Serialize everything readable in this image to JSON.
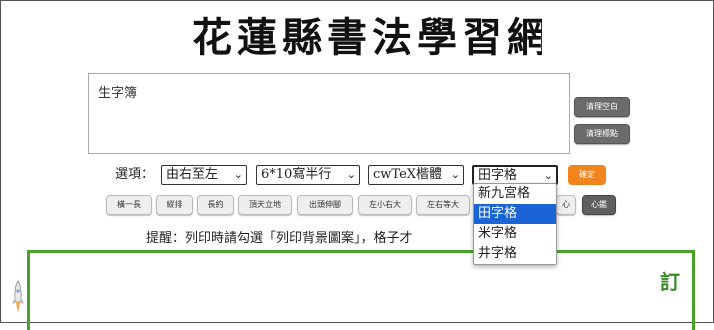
{
  "site": {
    "title": "花蓮縣書法學習網"
  },
  "editor": {
    "text": "生字簿"
  },
  "side_buttons": [
    {
      "label": "清理空白"
    },
    {
      "label": "清理標點"
    }
  ],
  "options": {
    "label": "選項：",
    "direction": "由右至左",
    "layout": "6*10寫半行",
    "font": "cwTeX楷體",
    "grid": "田字格"
  },
  "confirm_label": "確定",
  "grid_dropdown": {
    "options": [
      "新九宮格",
      "田字格",
      "米字格",
      "井字格"
    ],
    "selected_index": 1
  },
  "mode_buttons": [
    "橫一長",
    "縱排",
    "長約",
    "頂天立地",
    "出頭伸腳",
    "左小右大",
    "左右等大",
    "",
    "心",
    "心鑑"
  ],
  "tip": "提醒：列印時請勾選「列印背景圖案」，格子才",
  "tip_end": "。",
  "preview": {
    "char": "訂"
  },
  "colors": {
    "accent_green": "#4aa329",
    "confirm_orange": "#f0841e",
    "selected_blue": "#1a64d6"
  }
}
